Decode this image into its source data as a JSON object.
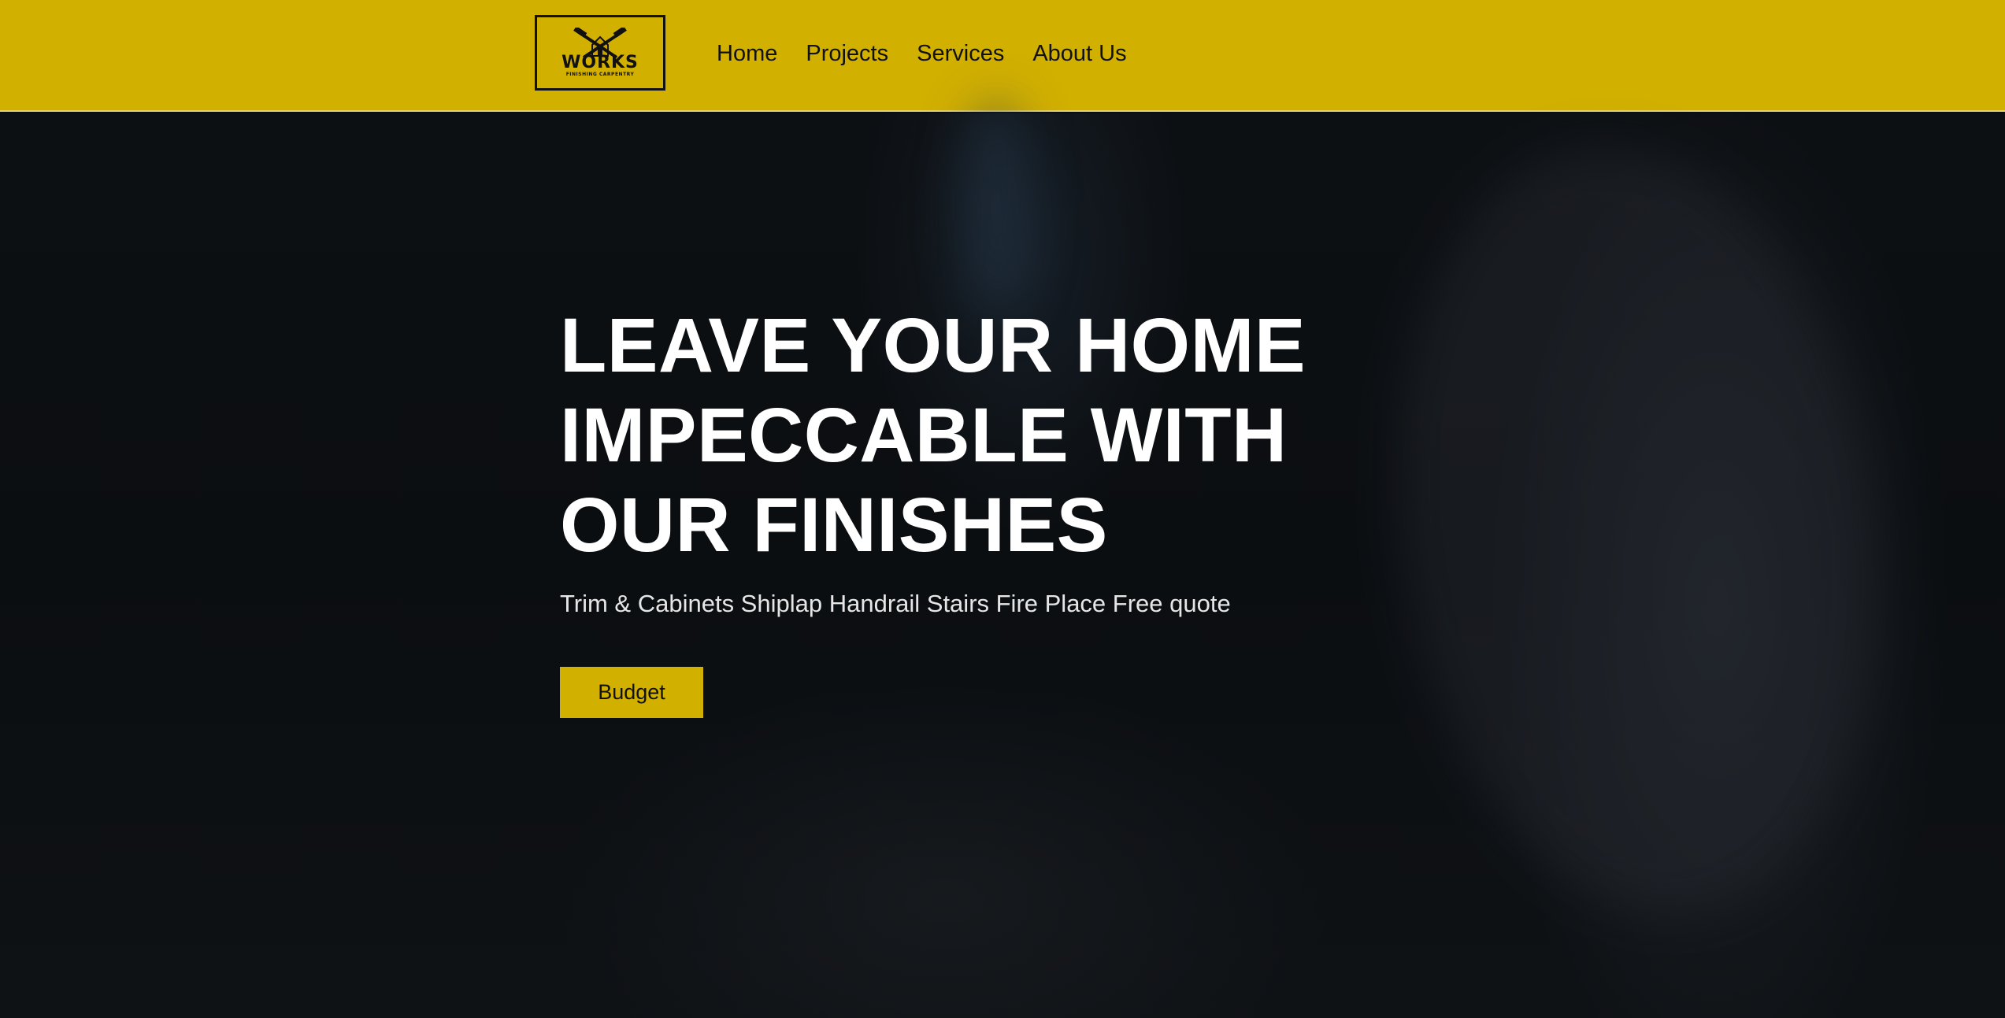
{
  "header": {
    "background_color": "#d2b000",
    "logo": {
      "icon": "crossed-hammers-house-icon",
      "wordmark": "WORKS",
      "tagline": "FINISHING CARPENTRY"
    },
    "nav": [
      {
        "label": "Home"
      },
      {
        "label": "Projects"
      },
      {
        "label": "Services"
      },
      {
        "label": "About Us"
      }
    ]
  },
  "hero": {
    "headline": "LEAVE YOUR HOME IMPECCABLE WITH OUR FINISHES",
    "subheadline": "Trim & Cabinets Shiplap Handrail Stairs Fire Place Free quote",
    "cta_label": "Budget",
    "cta_color": "#d2b000"
  }
}
